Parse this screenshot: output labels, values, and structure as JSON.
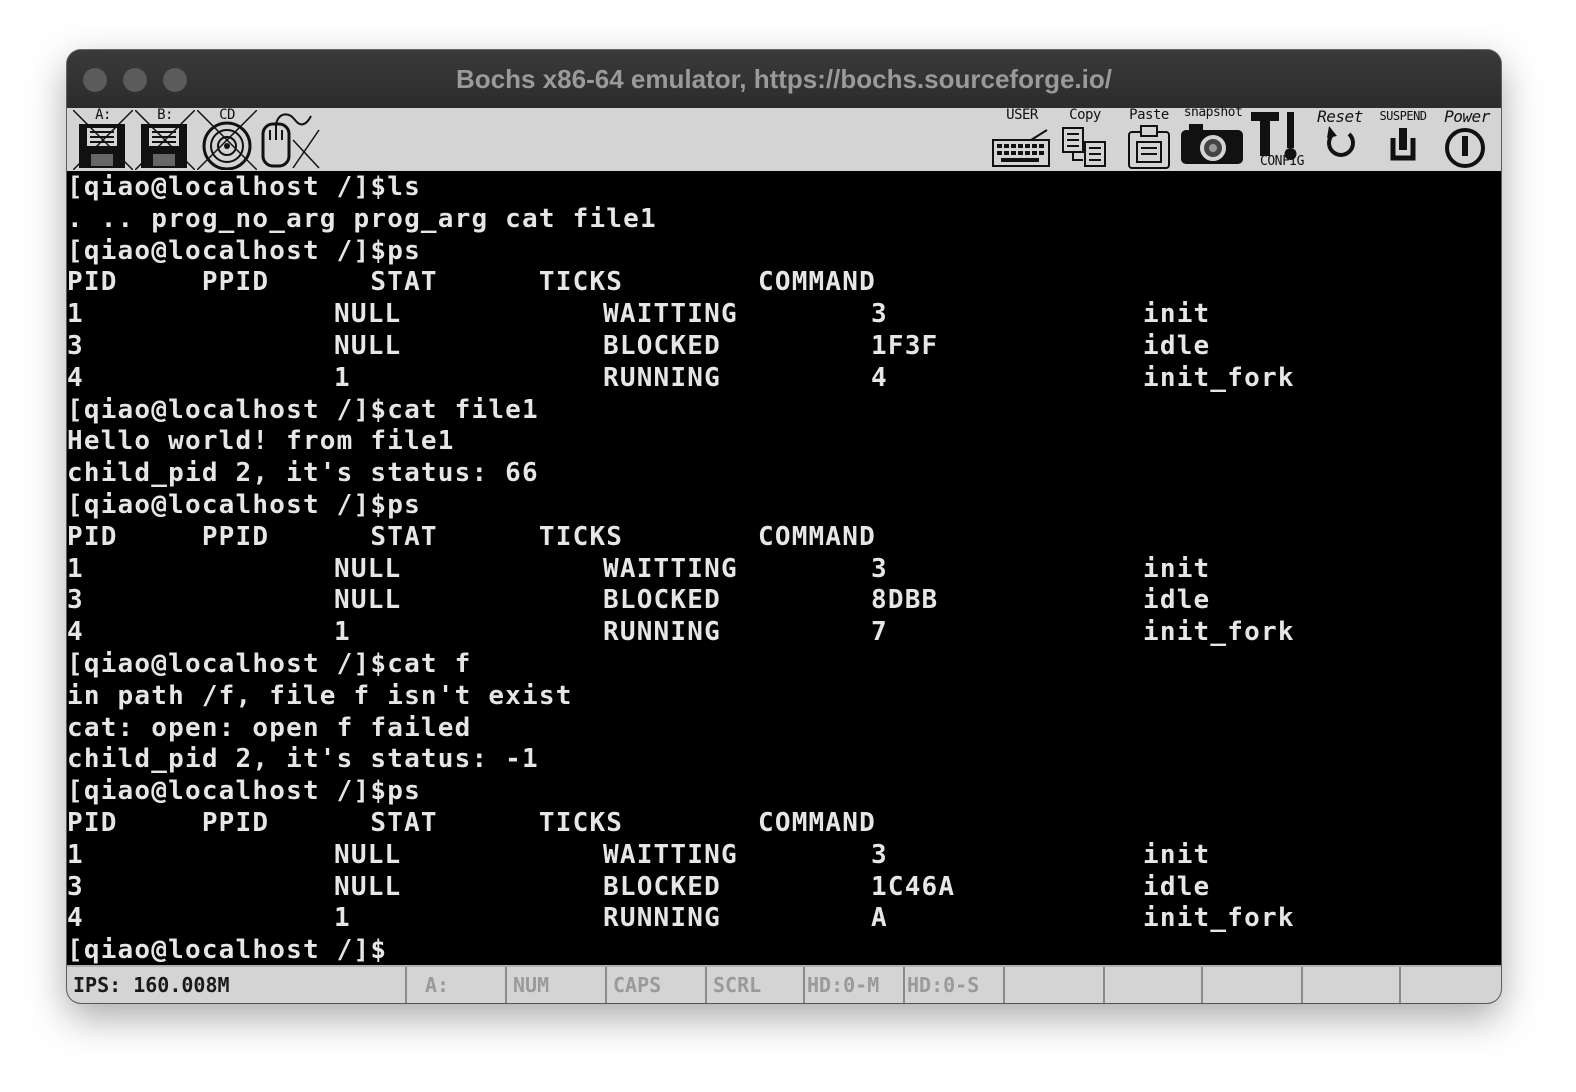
{
  "window": {
    "title": "Bochs x86-64 emulator, https://bochs.sourceforge.io/"
  },
  "toolbar": {
    "floppy_a": "A:",
    "floppy_b": "B:",
    "cdrom": "CD",
    "user": "USER",
    "copy": "Copy",
    "paste": "Paste",
    "snapshot": "snapshot",
    "config": "CONFIG",
    "reset": "Reset",
    "suspend": "SUSPEND",
    "power": "Power"
  },
  "terminal": {
    "lines": [
      "[qiao@localhost /]$ls",
      ". .. prog_no_arg prog_arg cat file1",
      "[qiao@localhost /]$ps",
      "PID     PPID      STAT      TICKS        COMMAND",
      "",
      "",
      "",
      "[qiao@localhost /]$cat file1",
      "Hello world! from file1",
      "child_pid 2, it's status: 66",
      "[qiao@localhost /]$ps",
      "PID     PPID      STAT      TICKS        COMMAND",
      "",
      "",
      "",
      "[qiao@localhost /]$cat f",
      "in path /f, file f isn't exist",
      "cat: open: open f failed",
      "child_pid 2, it's status: -1",
      "[qiao@localhost /]$ps",
      "PID     PPID      STAT      TICKS        COMMAND",
      "",
      "",
      "",
      "[qiao@localhost /]$"
    ],
    "ps_tables": [
      {
        "rows": [
          [
            "1",
            "NULL",
            "WAITTING",
            "3",
            "init"
          ],
          [
            "3",
            "NULL",
            "BLOCKED",
            "1F3F",
            "idle"
          ],
          [
            "4",
            "1",
            "RUNNING",
            "4",
            "init_fork"
          ]
        ]
      },
      {
        "rows": [
          [
            "1",
            "NULL",
            "WAITTING",
            "3",
            "init"
          ],
          [
            "3",
            "NULL",
            "BLOCKED",
            "8DBB",
            "idle"
          ],
          [
            "4",
            "1",
            "RUNNING",
            "7",
            "init_fork"
          ]
        ]
      },
      {
        "rows": [
          [
            "1",
            "NULL",
            "WAITTING",
            "3",
            "init"
          ],
          [
            "3",
            "NULL",
            "BLOCKED",
            "1C46A",
            "idle"
          ],
          [
            "4",
            "1",
            "RUNNING",
            "A",
            "init_fork"
          ]
        ]
      }
    ]
  },
  "statusbar": {
    "ips": "IPS: 160.008M",
    "floppy": "A:",
    "num": "NUM",
    "caps": "CAPS",
    "scrl": "SCRL",
    "hd0m": "HD:0-M",
    "hd0s": "HD:0-S"
  }
}
